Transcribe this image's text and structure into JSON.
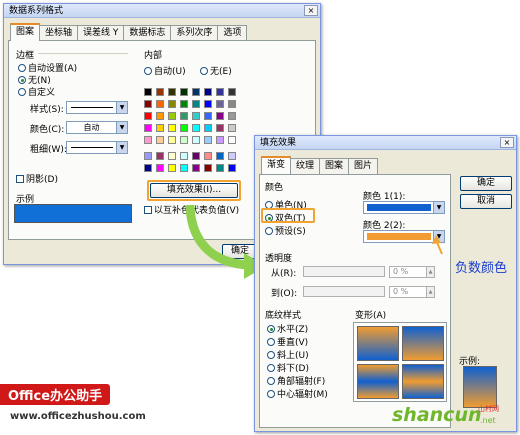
{
  "dialog1": {
    "title": "数据系列格式",
    "close": "×",
    "tabs": [
      "图案",
      "坐标轴",
      "误差线 Y",
      "数据标志",
      "系列次序",
      "选项"
    ],
    "border_label": "边框",
    "auto_setting": "自动设置(A)",
    "none": "无(N)",
    "custom": "自定义",
    "style_label": "样式(S):",
    "color_label": "颜色(C):",
    "color_value": "自动",
    "weight_label": "粗细(W):",
    "shadow_label": "阴影(D)",
    "sample_label": "示例",
    "fill_label": "内部",
    "fill_auto": "自动(U)",
    "fill_none": "无(E)",
    "fill_effect_button": "填充效果(I)...",
    "invert_label": "以互补色代表负值(V)",
    "ok_button": "确定"
  },
  "dialog2": {
    "title": "填充效果",
    "close": "×",
    "tabs": [
      "渐变",
      "纹理",
      "图案",
      "图片"
    ],
    "colors_label": "颜色",
    "single": "单色(N)",
    "two": "双色(T)",
    "preset": "预设(S)",
    "color1_label": "颜色 1(1):",
    "color2_label": "颜色 2(2):",
    "transparency_label": "透明度",
    "from_label": "从(R):",
    "to_label": "到(O):",
    "from_value": "0 %",
    "to_value": "0 %",
    "shading_label": "底纹样式",
    "variants_label": "变形(A)",
    "shading_styles": [
      "水平(Z)",
      "垂直(V)",
      "斜上(U)",
      "斜下(D)",
      "角部辐射(F)",
      "中心辐射(M)"
    ],
    "sample_label": "示例:",
    "ok_button": "确定",
    "cancel_button": "取消"
  },
  "annotation": "负数颜色",
  "watermark": {
    "brand": "Office办公助手",
    "url": "www.officezhushou.com",
    "logo": "shancun",
    "logo_sub": "山村网",
    "logo_net": ".net"
  },
  "colors": {
    "color1": "#1060d0",
    "color2": "#f09c30",
    "highlight": "#f2a330",
    "annotation": "#1a3fd0"
  }
}
